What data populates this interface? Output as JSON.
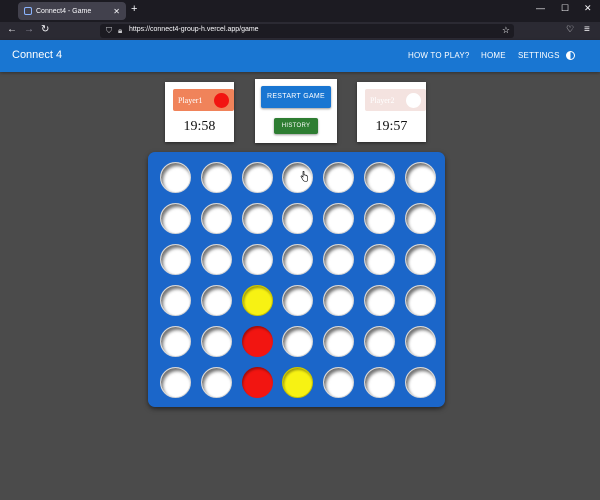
{
  "browser": {
    "tab_title": "Connect4 - Game",
    "tab_close": "✕",
    "new_tab": "+",
    "url": "https://connect4-group-h.vercel.app/game",
    "win_min": "—",
    "win_max": "☐",
    "win_close": "✕"
  },
  "app": {
    "title": "Connect 4",
    "nav": [
      "HOW TO PLAY?",
      "HOME",
      "SETTINGS"
    ]
  },
  "players": [
    {
      "label": "Player1",
      "time": "19:58",
      "chip_color": "#f0835a",
      "disc_color": "#f21511"
    },
    {
      "label": "Player2",
      "time": "19:57",
      "chip_color": "#f4e3e0",
      "disc_color": "#ffffff"
    }
  ],
  "controls": {
    "restart_label": "RESTART GAME",
    "history_label": "HISTORY"
  },
  "colors": {
    "appbar": "#1976d2",
    "board": "#1b66c9",
    "red": "#f21511",
    "yellow": "#f7f213",
    "history_button": "#2e7d32",
    "restart_button": "#1976d2"
  },
  "board": {
    "rows": 6,
    "cols": 7,
    "grid": [
      [
        "",
        "",
        "",
        "",
        "",
        "",
        ""
      ],
      [
        "",
        "",
        "",
        "",
        "",
        "",
        ""
      ],
      [
        "",
        "",
        "",
        "",
        "",
        "",
        ""
      ],
      [
        "",
        "",
        "yellow",
        "",
        "",
        "",
        ""
      ],
      [
        "",
        "",
        "red",
        "",
        "",
        "",
        ""
      ],
      [
        "",
        "",
        "red",
        "yellow",
        "",
        "",
        ""
      ]
    ]
  }
}
